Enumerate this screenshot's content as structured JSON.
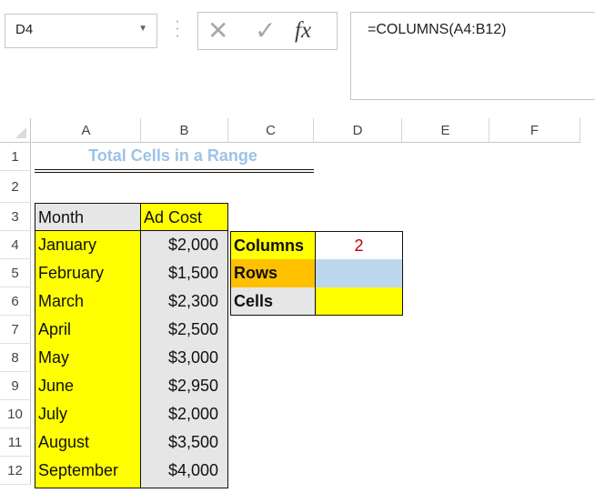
{
  "formula_bar": {
    "name_box": "D4",
    "name_box_dropdown_icon": "chevron-down",
    "cancel_icon": "✕",
    "enter_icon": "✓",
    "fx_label": "fx",
    "formula": "=COLUMNS(A4:B12)"
  },
  "columns": [
    "A",
    "B",
    "C",
    "D",
    "E",
    "F"
  ],
  "rows": [
    "1",
    "2",
    "3",
    "4",
    "5",
    "6",
    "7",
    "8",
    "9",
    "10",
    "11",
    "12"
  ],
  "title": "Total Cells in a Range",
  "table": {
    "header": {
      "month": "Month",
      "cost": "Ad Cost"
    },
    "data": [
      {
        "month": "January",
        "cost": "$2,000"
      },
      {
        "month": "February",
        "cost": "$1,500"
      },
      {
        "month": "March",
        "cost": "$2,300"
      },
      {
        "month": "April",
        "cost": "$2,500"
      },
      {
        "month": "May",
        "cost": "$3,000"
      },
      {
        "month": "June",
        "cost": "$2,950"
      },
      {
        "month": "July",
        "cost": "$2,000"
      },
      {
        "month": "August",
        "cost": "$3,500"
      },
      {
        "month": "September",
        "cost": "$4,000"
      }
    ]
  },
  "summary": {
    "columns_label": "Columns",
    "columns_value": "2",
    "rows_label": "Rows",
    "rows_value": "",
    "cells_label": "Cells",
    "cells_value": ""
  },
  "colors": {
    "yellow": "#ffff00",
    "grey": "#e6e6e6",
    "orange": "#ffc000",
    "light_blue": "#bdd7ee",
    "title": "#9dc3e6",
    "value_red": "#c00000"
  }
}
